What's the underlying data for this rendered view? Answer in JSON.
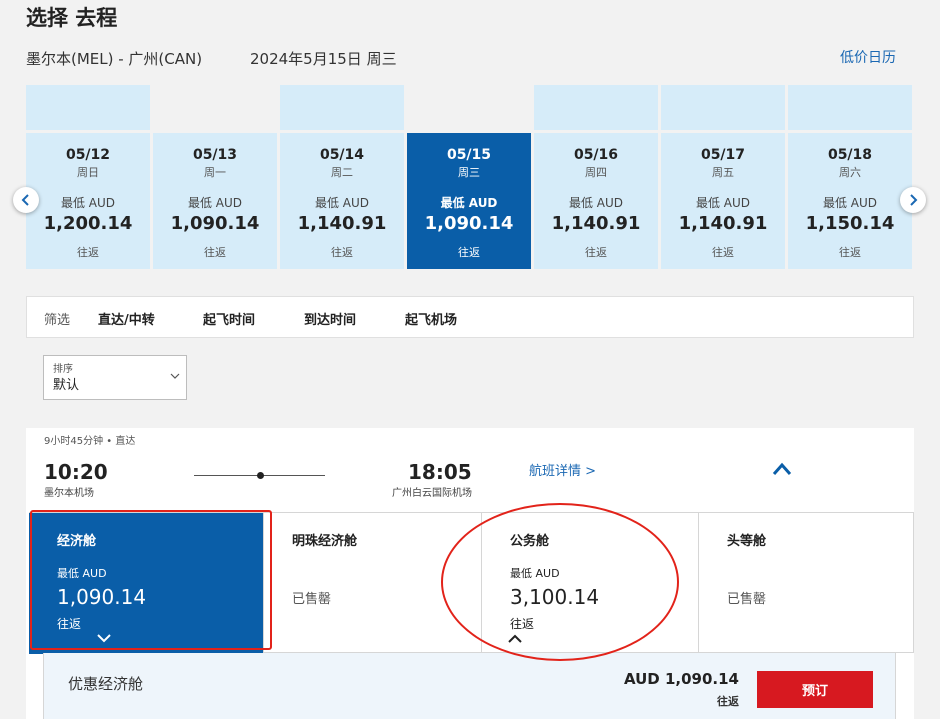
{
  "header": {
    "title": "选择 去程",
    "route": "墨尔本(MEL) - 广州(CAN)",
    "date": "2024年5月15日 周三",
    "calendar_link": "低价日历"
  },
  "dates": [
    {
      "date": "05/12",
      "weekday": "周日",
      "label": "最低 AUD",
      "price": "1,200.14",
      "trip": "往返"
    },
    {
      "date": "05/13",
      "weekday": "周一",
      "label": "最低 AUD",
      "price": "1,090.14",
      "trip": "往返"
    },
    {
      "date": "05/14",
      "weekday": "周二",
      "label": "最低 AUD",
      "price": "1,140.91",
      "trip": "往返"
    },
    {
      "date": "05/15",
      "weekday": "周三",
      "label": "最低 AUD",
      "price": "1,090.14",
      "trip": "往返"
    },
    {
      "date": "05/16",
      "weekday": "周四",
      "label": "最低 AUD",
      "price": "1,140.91",
      "trip": "往返"
    },
    {
      "date": "05/17",
      "weekday": "周五",
      "label": "最低 AUD",
      "price": "1,140.91",
      "trip": "往返"
    },
    {
      "date": "05/18",
      "weekday": "周六",
      "label": "最低 AUD",
      "price": "1,150.14",
      "trip": "往返"
    }
  ],
  "filters": {
    "label": "筛选",
    "items": [
      "直达/中转",
      "起飞时间",
      "到达时间",
      "起飞机场"
    ]
  },
  "sort": {
    "label": "排序",
    "value": "默认"
  },
  "flight": {
    "meta": "9小时45分钟 • 直达",
    "dep_time": "10:20",
    "dep_airport": "墨尔本机场",
    "arr_time": "18:05",
    "arr_airport": "广州白云国际机场",
    "details_link": "航班详情 >"
  },
  "cabins": [
    {
      "name": "经济舱",
      "label": "最低 AUD",
      "price": "1,090.14",
      "trip": "往返"
    },
    {
      "name": "明珠经济舱",
      "status": "已售罄"
    },
    {
      "name": "公务舱",
      "label": "最低 AUD",
      "price": "3,100.14",
      "trip": "往返"
    },
    {
      "name": "头等舱",
      "status": "已售罄"
    }
  ],
  "fare": {
    "name": "优惠经济舱",
    "price": "AUD 1,090.14",
    "trip": "往返",
    "book_label": "预订"
  },
  "colors": {
    "primary_blue": "#0a5ea8",
    "light_blue": "#d6ecf9",
    "link_blue": "#1b68b3",
    "book_red": "#d71920",
    "annotation_red": "#e2231a"
  }
}
